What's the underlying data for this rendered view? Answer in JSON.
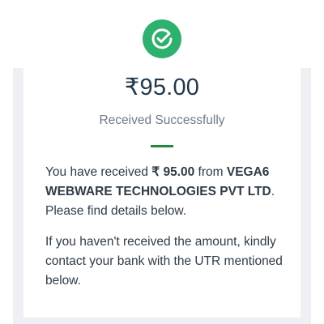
{
  "header": {
    "icon": "check-circle-icon",
    "icon_color": "#2fb06e"
  },
  "transaction": {
    "amount": "₹95.00",
    "status": "Received Successfully",
    "divider_color": "#1f8a3c"
  },
  "message": {
    "line1_prefix": "You have received ",
    "amount_bold": "₹ 95.00",
    "line1_suffix": " from",
    "company": "VEGA6 WEBWARE TECHNOLOGIES PVT LTD",
    "details": ". Please find details below.",
    "help": "If you haven't received the amount, kindly contact your bank with the UTR mentioned below."
  }
}
